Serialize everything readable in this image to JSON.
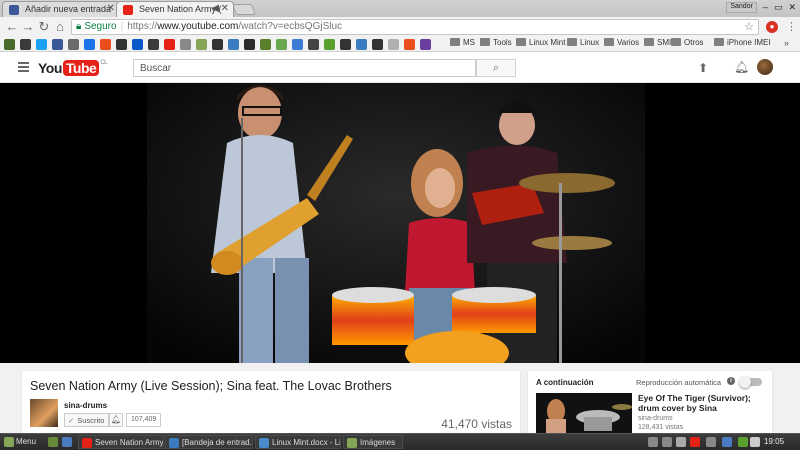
{
  "browser": {
    "tabs": [
      {
        "title": "Añadir nueva entrada",
        "active": false,
        "favicon_color": "#3b5998"
      },
      {
        "title": "Seven Nation Army (",
        "active": true,
        "favicon_color": "#e62117",
        "audio": true
      }
    ],
    "window_user": "Sandor",
    "omnibox": {
      "secure_label": "Seguro",
      "url_scheme": "https://",
      "url_host": "www.youtube.com",
      "url_path": "/watch?v=ecbsQGjSluc"
    },
    "bookmarks": {
      "icons": [
        "#4a6a2a",
        "#3a3a3a",
        "#1da1f2",
        "#3b5998",
        "#6b6b6b",
        "#1a73e8",
        "#e94e1b",
        "#333333",
        "#0a58ca",
        "#3a3a3a",
        "#e62117",
        "#888888",
        "#87a556",
        "#333333",
        "#3b7bbf",
        "#2a2a2a",
        "#5b7f2a",
        "#6aa84f",
        "#3a7bd5",
        "#444444",
        "#5aa02c",
        "#333333",
        "#3b7bbf",
        "#333333",
        "#b0b0b0",
        "#e94e1b",
        "#6b3fa0"
      ],
      "folders": [
        "MS",
        "Tools",
        "Linux Mint",
        "Linux",
        "Varios",
        "SMI",
        "Otros",
        "iPhone IMEI"
      ],
      "more": "»"
    }
  },
  "youtube": {
    "logo_you": "You",
    "logo_tube": "Tube",
    "logo_country": "CL",
    "search_placeholder": "Buscar"
  },
  "video": {
    "title": "Seven Nation Army (Live Session); Sina feat. The Lovac Brothers",
    "channel": "sina-drums",
    "subscribe_label": "Suscrito",
    "subscriber_count": "107,409",
    "views": "41,470 vistas"
  },
  "sidebar": {
    "next_label": "A continuación",
    "autoplay_label": "Reproducción automática",
    "autoplay_on": false,
    "next_video": {
      "title": "Eye Of The Tiger (Survivor); drum cover by Sina",
      "channel": "sina-drums",
      "views": "128,431 vistas"
    }
  },
  "taskbar": {
    "menu_label": "Menu",
    "items": [
      {
        "label": "Seven Nation Army ...",
        "color": "#e62117"
      },
      {
        "label": "[Bandeja de entrad...",
        "color": "#3b7bbf"
      },
      {
        "label": "Linux Mint.docx - Li...",
        "color": "#4a8acb"
      },
      {
        "label": "Imágenes",
        "color": "#87a556"
      }
    ],
    "clock": "19:05"
  }
}
